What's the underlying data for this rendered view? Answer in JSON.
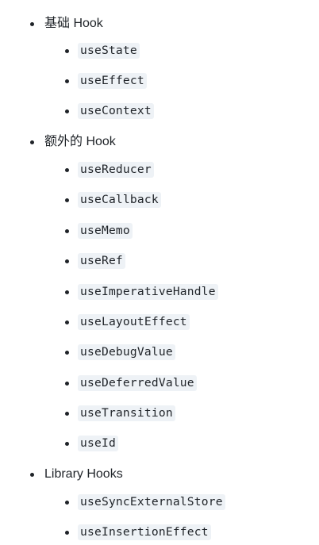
{
  "sections": [
    {
      "title": "基础 Hook",
      "items": [
        "useState",
        "useEffect",
        "useContext"
      ]
    },
    {
      "title": "额外的 Hook",
      "items": [
        "useReducer",
        "useCallback",
        "useMemo",
        "useRef",
        "useImperativeHandle",
        "useLayoutEffect",
        "useDebugValue",
        "useDeferredValue",
        "useTransition",
        "useId"
      ]
    },
    {
      "title": "Library Hooks",
      "items": [
        "useSyncExternalStore",
        "useInsertionEffect"
      ]
    }
  ]
}
